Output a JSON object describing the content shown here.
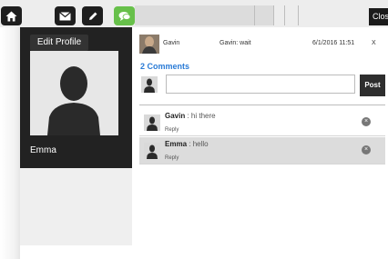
{
  "toolbar": {
    "nav": [
      {
        "icon": "home-icon"
      },
      {
        "icon": "envelope-icon"
      },
      {
        "icon": "pencil-icon"
      },
      {
        "icon": "chat-bubble-icon",
        "active": true
      }
    ],
    "close_label": "Close",
    "active_color": "#67c04a"
  },
  "profile": {
    "edit_label": "Edit Profile",
    "name": "Emma"
  },
  "post": {
    "author": "Gavin",
    "message": "Gavin: wait",
    "timestamp": "6/1/2016 11:51",
    "close": "X"
  },
  "comments": {
    "title": "2 Comments",
    "input_placeholder": "",
    "post_button": "Post",
    "items": [
      {
        "author": "Gavin",
        "text": "hi there",
        "reply": "Reply",
        "delete": "×"
      },
      {
        "author": "Emma",
        "text": "hello",
        "reply": "Reply",
        "delete": "×"
      }
    ]
  },
  "colors": {
    "link_blue": "#2a7bd6",
    "dark_panel": "#222222"
  }
}
